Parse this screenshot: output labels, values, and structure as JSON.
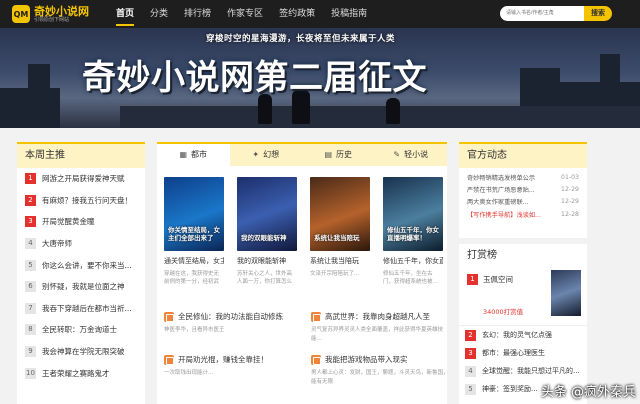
{
  "site": {
    "logo_text": "奇妙小说网",
    "logo_sub": "引领原创下网站",
    "logo_badge": "QM"
  },
  "nav": [
    "首页",
    "分类",
    "排行榜",
    "作家专区",
    "签约政策",
    "投稿指南"
  ],
  "search": {
    "placeholder": "请输入书名/作者/主角",
    "button": "搜索"
  },
  "banner": {
    "tagline": "穿梭时空的星海漫游，长夜将至但未来属于人类",
    "title": "奇妙小说网第二届征文"
  },
  "weekly": {
    "title": "本周主推",
    "items": [
      {
        "rank": "1",
        "title": "网游之开局获得爱神天赋"
      },
      {
        "rank": "2",
        "title": "有麻烦？接我五行问天盘！"
      },
      {
        "rank": "3",
        "title": "开局觉醒黄金瞳"
      },
      {
        "rank": "4",
        "title": "大唐帝师"
      },
      {
        "rank": "5",
        "title": "你这么会讲，要不你来当..."
      },
      {
        "rank": "6",
        "title": "别怀疑，我就是位面之神"
      },
      {
        "rank": "7",
        "title": "我吞下穿越后在都市当祈..."
      },
      {
        "rank": "8",
        "title": "全民转职：万金询道士"
      },
      {
        "rank": "9",
        "title": "我会神算在学院无限突破"
      },
      {
        "rank": "10",
        "title": "王者荣耀之赛路鬼才"
      }
    ]
  },
  "tabs": [
    "都市",
    "幻想",
    "历史",
    "轻小说"
  ],
  "books": [
    {
      "cover_text": "你关情至结局，女主们全部出来了",
      "title": "通关情至结局，女主们全跑出...",
      "desc": "穿越在这，我获得史无前例的第一分，经初武位..."
    },
    {
      "cover_text": "我的双眼能斩神",
      "title": "我的双眼能斩神",
      "desc": "苏轩关心之人，世外高人面一万，你打算怎么了？"
    },
    {
      "cover_text": "系统让我当陪玩",
      "title": "系统让我当陪玩",
      "desc": "文泽开宗陪陪玩了..."
    },
    {
      "cover_text": "修仙五千年，你女直播明爆率！",
      "title": "修仙五千年，你女直播明爆...",
      "desc": "修仙五千年，坐在古门，获得超系统也被..."
    }
  ],
  "list_items": [
    {
      "title": "全民修仙：我的功法能自动修炼",
      "desc": "神医李华，且看异市医王"
    },
    {
      "title": "高武世界：我靠肉身超越凡人圣",
      "desc": "灵气复苏异界灵灵人类全面覆盖，祥此获得华夏英雄技能..."
    },
    {
      "title": "开局劝光棍，赚钱全靠挂！",
      "desc": "一次取钱出现能计..."
    },
    {
      "title": "我能把游戏物品带入现实",
      "desc": "男人都上心灵：发财，国王，聊题，斗灵天鸟，新鲁国，能有无限"
    }
  ],
  "official": {
    "title": "官方动态",
    "items": [
      {
        "title": "奇妙畅销精选发榜单公示",
        "date": "01-03",
        "hl": false
      },
      {
        "title": "严禁在书荒广场恶意贴...",
        "date": "12-29",
        "hl": false
      },
      {
        "title": "两大奥女作家重磅联...",
        "date": "12-29",
        "hl": false
      },
      {
        "title": "【写作携手导航】浅谈如...",
        "date": "12-28",
        "hl": true
      }
    ]
  },
  "reward": {
    "title": "打赏榜",
    "first_name": "玉佩空间",
    "first_amount": "34000打赏值",
    "items": [
      {
        "rank": "2",
        "title": "玄幻：我的灵气亿点强"
      },
      {
        "rank": "3",
        "title": "都市：最强心理医生"
      },
      {
        "rank": "4",
        "title": "全球觉醒：我能只想过平凡的..."
      },
      {
        "rank": "5",
        "title": "神豪：签到奖励..."
      }
    ]
  },
  "watermark": "头条 @疯外秦兵",
  "colors": {
    "accent": "#f5c400",
    "hot": "#e3322e",
    "nav_bg": "#1e1e1e"
  }
}
